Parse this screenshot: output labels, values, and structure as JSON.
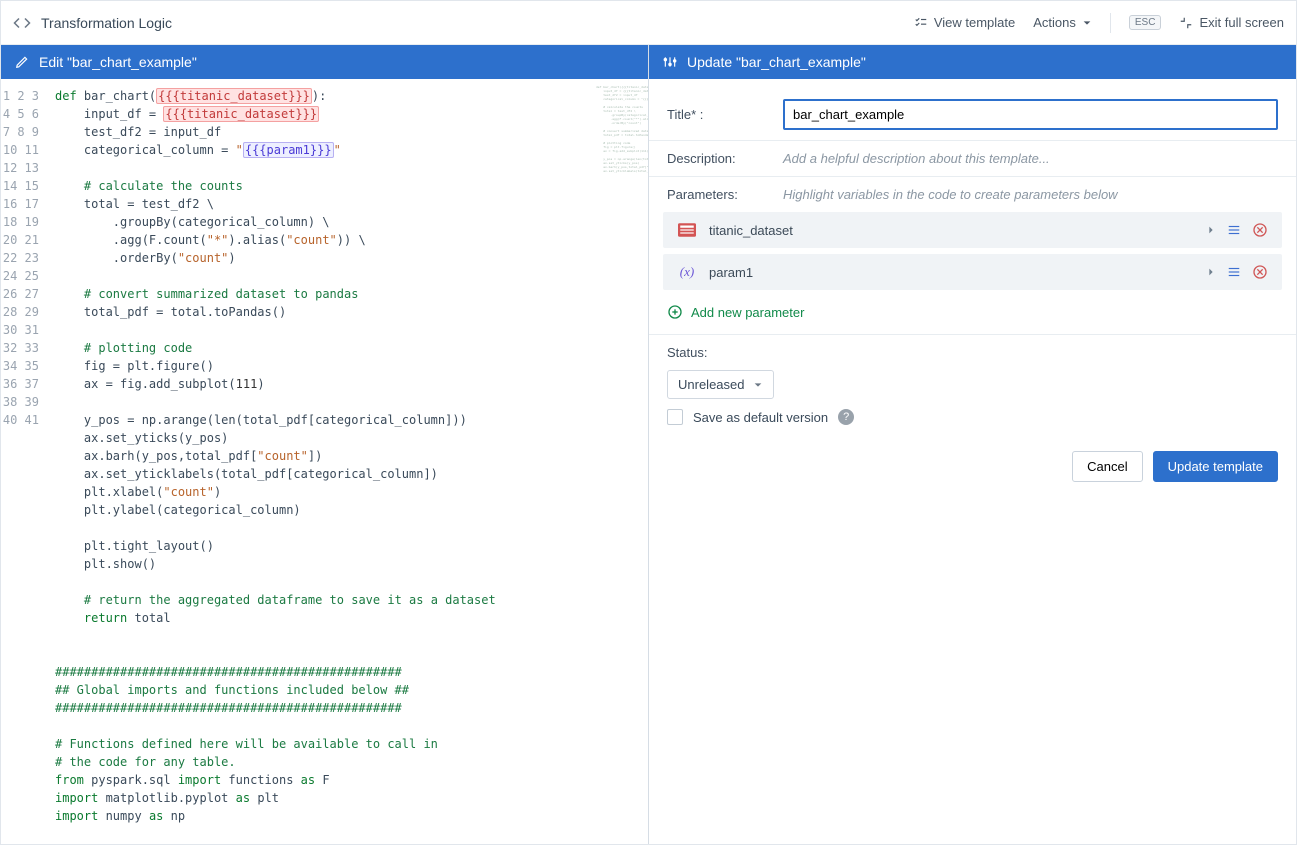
{
  "topbar": {
    "title": "Transformation Logic",
    "view_template": "View template",
    "actions": "Actions",
    "esc": "ESC",
    "exit": "Exit full screen"
  },
  "left": {
    "header": "Edit \"bar_chart_example\""
  },
  "right": {
    "header": "Update \"bar_chart_example\"",
    "title_label": "Title* :",
    "title_value": "bar_chart_example",
    "desc_label": "Description:",
    "desc_placeholder": "Add a helpful description about this template...",
    "params_label": "Parameters:",
    "params_hint": "Highlight variables in the code to create parameters below",
    "params": [
      {
        "name": "titanic_dataset",
        "type": "dataset"
      },
      {
        "name": "param1",
        "type": "variable"
      }
    ],
    "add_param": "Add new parameter",
    "status_label": "Status:",
    "status_value": "Unreleased",
    "save_default": "Save as default version",
    "cancel": "Cancel",
    "update": "Update template"
  },
  "code": {
    "line_count": 41,
    "param_dataset": "{{{titanic_dataset}}}",
    "param_var": "{{{param1}}}"
  }
}
